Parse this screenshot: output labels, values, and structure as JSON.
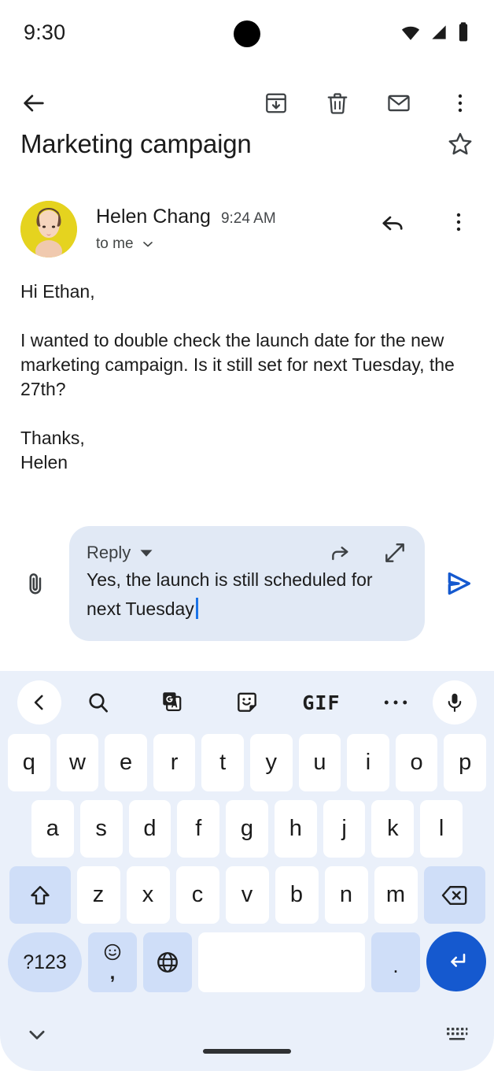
{
  "status_bar": {
    "time": "9:30",
    "icons": [
      "wifi-icon",
      "cellular-signal-icon",
      "battery-icon"
    ]
  },
  "toolbar": {
    "back_icon": "back-arrow-icon",
    "archive_icon": "archive-icon",
    "delete_icon": "trash-icon",
    "mark_unread_icon": "envelope-icon",
    "overflow_icon": "more-vert-icon"
  },
  "email": {
    "subject": "Marketing campaign",
    "star_icon": "star-outline-icon",
    "sender_name": "Helen Chang",
    "time": "9:24 AM",
    "recipients": "to me",
    "recipients_caret_icon": "chevron-down-icon",
    "reply_icon": "reply-arrow-icon",
    "overflow_icon": "more-vert-icon",
    "body": "Hi Ethan,\n\nI wanted to double check the launch date for the new marketing campaign. Is it still set for next Tuesday, the 27th?\n\nThanks,\nHelen"
  },
  "compose": {
    "attach_icon": "paperclip-icon",
    "reply_mode_label": "Reply",
    "reply_mode_caret_icon": "caret-down-icon",
    "forward_icon": "forward-arrow-icon",
    "expand_icon": "expand-diagonal-icon",
    "draft_text": "Yes, the launch is still scheduled for next Tuesday",
    "send_icon": "send-icon",
    "accent_color": "#1559cf",
    "card_color": "#e1e9f5"
  },
  "keyboard": {
    "background_color": "#eaf0fa",
    "key_color": "#ffffff",
    "function_key_color": "#cfdef8",
    "enter_key_color": "#1559cf",
    "toolbar_icons": [
      "chevron-left-icon",
      "search-icon",
      "translate-icon",
      "sticker-icon",
      "gif-icon",
      "more-horiz-icon",
      "mic-icon"
    ],
    "gif_label": "GIF",
    "rows": [
      [
        "q",
        "w",
        "e",
        "r",
        "t",
        "y",
        "u",
        "i",
        "o",
        "p"
      ],
      [
        "a",
        "s",
        "d",
        "f",
        "g",
        "h",
        "j",
        "k",
        "l"
      ],
      [
        "z",
        "x",
        "c",
        "v",
        "b",
        "n",
        "m"
      ]
    ],
    "shift_icon": "shift-up-icon",
    "backspace_icon": "backspace-icon",
    "symbols_label": "?123",
    "emoji_icon": "emoji-smile-icon",
    "comma_label": ",",
    "globe_icon": "globe-icon",
    "space_label": "",
    "period_label": ".",
    "enter_icon": "enter-return-icon"
  },
  "nav_bar": {
    "hide_keyboard_icon": "chevron-down-icon",
    "switch_keyboard_icon": "keyboard-icon"
  }
}
